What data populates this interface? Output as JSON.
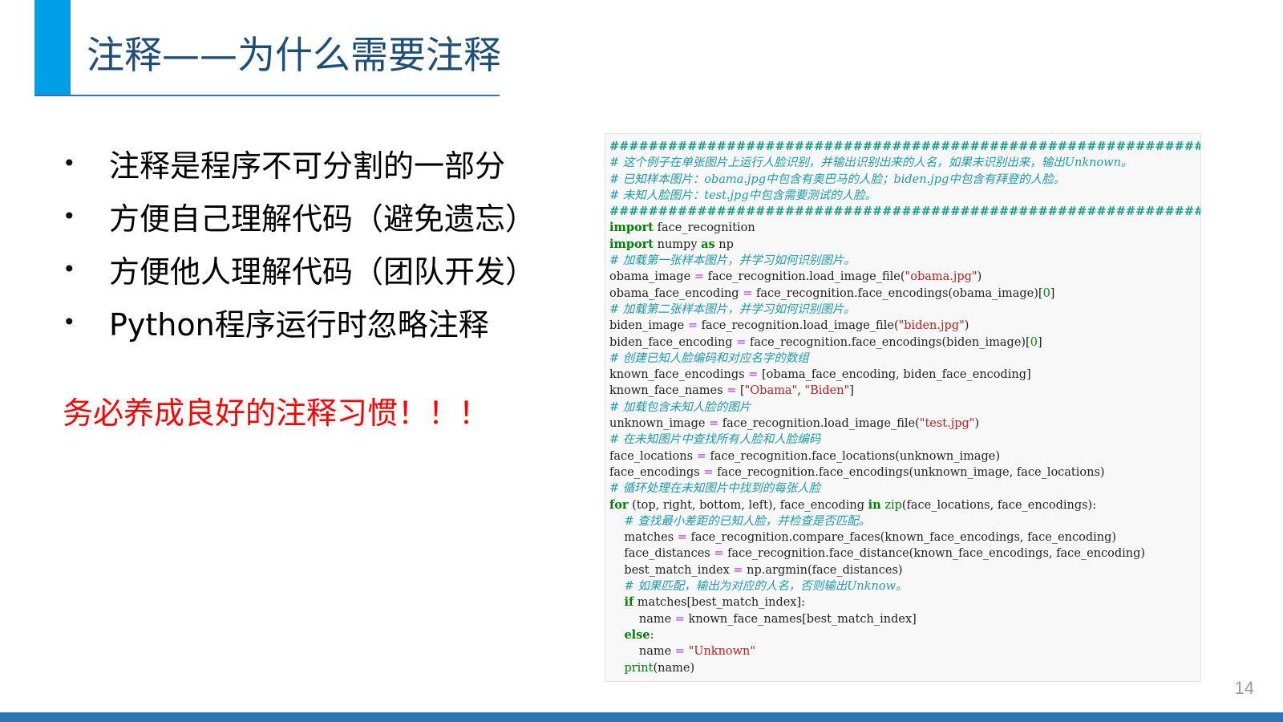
{
  "slide": {
    "title": "注释——为什么需要注释",
    "bullets": [
      "注释是程序不可分割的一部分",
      "方便自己理解代码（避免遗忘）",
      "方便他人理解代码（团队开发）",
      "Python程序运行时忽略注释"
    ],
    "bullet_symbol": "•",
    "warning": "务必养成良好的注释习惯！！！",
    "page_number": "14"
  },
  "code": {
    "lines": [
      "##################################################################################",
      "# 这个例子在单张图片上运行人脸识别，并输出识别出来的人名，如果未识别出来，输出Unknown。",
      "# 已知样本图片：obama.jpg中包含有奥巴马的人脸；biden.jpg中包含有拜登的人脸。",
      "# 未知人脸图片：test.jpg中包含需要测试的人脸。",
      "##################################################################################",
      "import face_recognition",
      "import numpy as np",
      "# 加载第一张样本图片，并学习如何识别图片。",
      "obama_image = face_recognition.load_image_file(\"obama.jpg\")",
      "obama_face_encoding = face_recognition.face_encodings(obama_image)[0]",
      "# 加载第二张样本图片，并学习如何识别图片。",
      "biden_image = face_recognition.load_image_file(\"biden.jpg\")",
      "biden_face_encoding = face_recognition.face_encodings(biden_image)[0]",
      "# 创建已知人脸编码和对应名字的数组",
      "known_face_encodings = [obama_face_encoding, biden_face_encoding]",
      "known_face_names = [\"Obama\", \"Biden\"]",
      "# 加载包含未知人脸的图片",
      "unknown_image = face_recognition.load_image_file(\"test.jpg\")",
      "# 在未知图片中查找所有人脸和人脸编码",
      "face_locations = face_recognition.face_locations(unknown_image)",
      "face_encodings = face_recognition.face_encodings(unknown_image, face_locations)",
      "# 循环处理在未知图片中找到的每张人脸",
      "for (top, right, bottom, left), face_encoding in zip(face_locations, face_encodings):",
      "    # 查找最小差距的已知人脸，并检查是否匹配。",
      "    matches = face_recognition.compare_faces(known_face_encodings, face_encoding)",
      "    face_distances = face_recognition.face_distance(known_face_encodings, face_encoding)",
      "    best_match_index = np.argmin(face_distances)",
      "    # 如果匹配，输出为对应的人名，否则输出Unknow。",
      "    if matches[best_match_index]:",
      "        name = known_face_names[best_match_index]",
      "    else:",
      "        name = \"Unknown\"",
      "    print(name)"
    ]
  },
  "colors": {
    "accent": "#00a0e9",
    "title": "#1f4e79",
    "rule": "#2e75b6",
    "warning": "#ff0000",
    "comment": "#1f9aa8",
    "keyword": "#008000",
    "string": "#ba2121"
  }
}
